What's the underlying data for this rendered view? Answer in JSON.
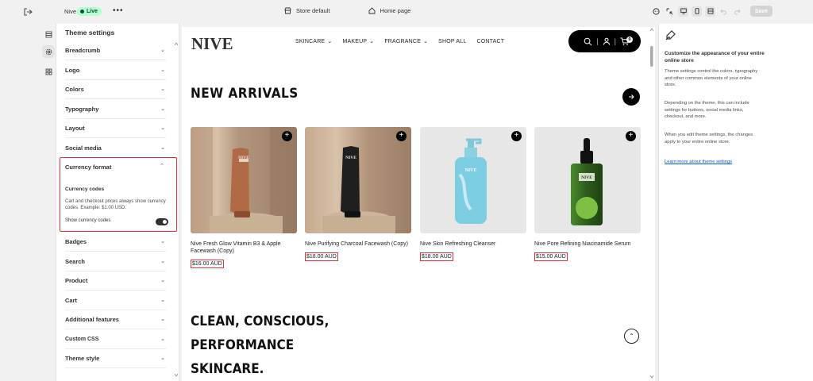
{
  "topbar": {
    "store_name": "Nive",
    "live_badge": "Live",
    "more": "•••",
    "store_selector": "Store default",
    "page_selector": "Home page",
    "save_label": "Save"
  },
  "settings": {
    "title": "Theme settings",
    "items_top": [
      "Breadcrumb",
      "Logo",
      "Colors",
      "Typography",
      "Layout",
      "Social media"
    ],
    "open_section": {
      "title": "Currency format",
      "subtitle": "Currency codes",
      "description": "Cart and checkout prices always show currency codes. Example: $1.00 USD.",
      "toggle_label": "Show currency codes",
      "toggle_on": true
    },
    "items_bottom": [
      "Badges",
      "Search",
      "Product",
      "Cart",
      "Additional features",
      "Custom CSS",
      "Theme style"
    ]
  },
  "preview": {
    "logo": "NIVE",
    "nav": [
      "SKINCARE",
      "MAKEUP",
      "FRAGRANCE",
      "SHOP ALL",
      "CONTACT"
    ],
    "cart_count": "0",
    "heading": "NEW ARRIVALS",
    "products": [
      {
        "name": "Nive Fresh Glow Vitamin B3 & Apple Facewash (Copy)",
        "price": "$16.00 AUD"
      },
      {
        "name": "Nive Purifying Charcoal Facewash (Copy)",
        "price": "$18.00 AUD"
      },
      {
        "name": "Nive Skin Refreshing Cleanser",
        "price": "$18.00 AUD"
      },
      {
        "name": "Nive Pore Refining Niacinamide Serum",
        "price": "$15.00 AUD"
      }
    ],
    "product_label": "NIVE",
    "heading2_lines": [
      "CLEAN, CONSCIOUS,",
      "PERFORMANCE",
      "SKINCARE."
    ]
  },
  "help": {
    "title": "Customize the appearance of your entire online store",
    "p1": "Theme settings control the colors, typography and other common elements of your online store.",
    "p2": "Depending on the theme, this can include settings for buttons, social media links, checkout, and more.",
    "p3": "When you edit theme settings, the changes apply to your entire online store.",
    "link": "Learn more about theme settings"
  },
  "colors": {
    "accent_highlight": "#e0323c",
    "live_green": "#b4fed2"
  }
}
